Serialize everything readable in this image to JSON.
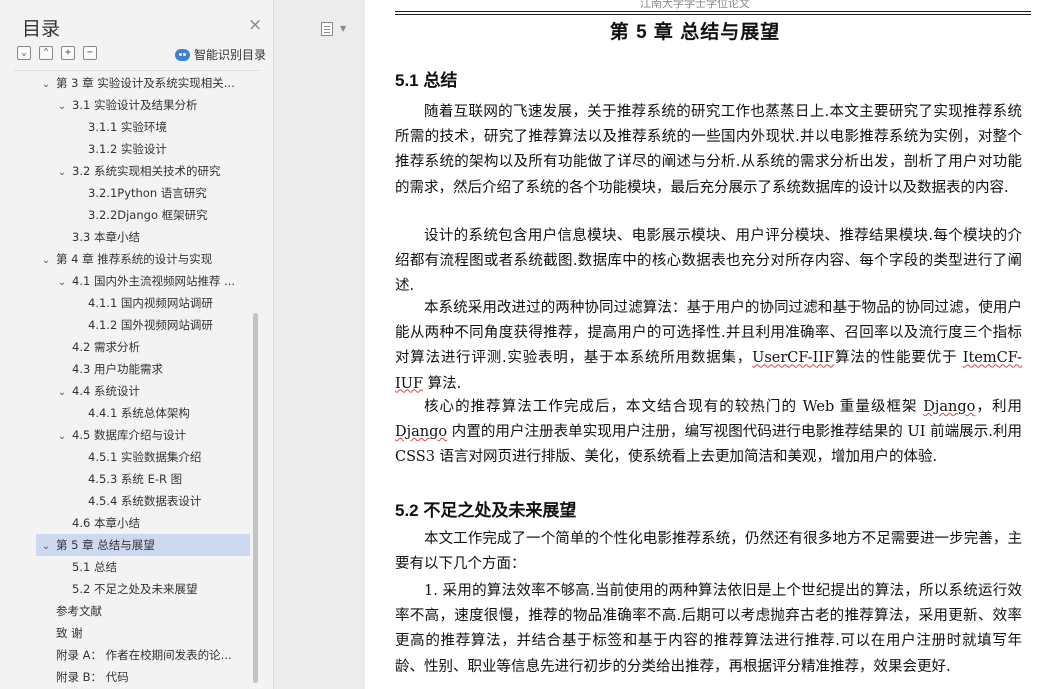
{
  "sidebar": {
    "title": "目录",
    "close_glyph": "×",
    "tools": [
      "⌄",
      "⌃",
      "+",
      "−"
    ],
    "ai_label": "智能识别目录",
    "toc": [
      {
        "label": "第 3 章 实验设计及系统实现相关...",
        "level": 1,
        "expand": true
      },
      {
        "label": "3.1 实验设计及结果分析",
        "level": 2,
        "expand": true
      },
      {
        "label": "3.1.1 实验环境",
        "level": 3,
        "expand": false
      },
      {
        "label": "3.1.2 实验设计",
        "level": 3,
        "expand": false
      },
      {
        "label": "3.2 系统实现相关技术的研究",
        "level": 2,
        "expand": true
      },
      {
        "label": "3.2.1Python 语言研究",
        "level": 3,
        "expand": false
      },
      {
        "label": "3.2.2Django 框架研究",
        "level": 3,
        "expand": false
      },
      {
        "label": "3.3 本章小结",
        "level": 2,
        "expand": false
      },
      {
        "label": "第 4 章 推荐系统的设计与实现",
        "level": 1,
        "expand": true
      },
      {
        "label": "4.1 国内外主流视频网站推荐 ...",
        "level": 2,
        "expand": true
      },
      {
        "label": "4.1.1 国内视频网站调研",
        "level": 3,
        "expand": false
      },
      {
        "label": "4.1.2 国外视频网站调研",
        "level": 3,
        "expand": false
      },
      {
        "label": "4.2 需求分析",
        "level": 2,
        "expand": false
      },
      {
        "label": "4.3 用户功能需求",
        "level": 2,
        "expand": false
      },
      {
        "label": "4.4 系统设计",
        "level": 2,
        "expand": true
      },
      {
        "label": "4.4.1 系统总体架构",
        "level": 3,
        "expand": false
      },
      {
        "label": "4.5 数据库介绍与设计",
        "level": 2,
        "expand": true
      },
      {
        "label": "4.5.1 实验数据集介绍",
        "level": 3,
        "expand": false
      },
      {
        "label": "4.5.3 系统 E-R 图",
        "level": 3,
        "expand": false
      },
      {
        "label": "4.5.4 系统数据表设计",
        "level": 3,
        "expand": false
      },
      {
        "label": "4.6 本章小结",
        "level": 2,
        "expand": false
      },
      {
        "label": "第 5 章 总结与展望",
        "level": 1,
        "expand": true,
        "selected": true
      },
      {
        "label": "5.1 总结",
        "level": 2,
        "expand": false
      },
      {
        "label": "5.2 不足之处及未来展望",
        "level": 2,
        "expand": false
      },
      {
        "label": "参考文献",
        "level": 1,
        "expand": false
      },
      {
        "label": "致 谢",
        "level": 1,
        "expand": false
      },
      {
        "label": "附录 A： 作者在校期间发表的论...",
        "level": 1,
        "expand": false
      },
      {
        "label": "附录 B： 代码",
        "level": 1,
        "expand": false
      }
    ]
  },
  "doc": {
    "running_head": "江南大学学士学位论文",
    "chapter_title": "第 5 章 总结与展望",
    "sections": [
      {
        "title": "5.1 总结",
        "paragraphs": [
          {
            "parts": [
              {
                "t": "随着互联网的飞速发展，关于推荐系统的研究工作也蒸蒸日上.本文主要研究了实现推荐系统所需的技术，研究了推荐算法以及推荐系统的一些国内外现状.并以电影推荐系统为实例，对整个推荐系统的架构以及所有功能做了详尽的阐述与分析.从系统的需求分析出发，剖析了用户对功能的需求，然后介绍了系统的各个功能模块，最后充分展示了系统数据库的设计以及数据表的内容."
              }
            ]
          },
          {
            "parts": [
              {
                "t": "设计的系统包含用户信息模块、电影展示模块、用户评分模块、推荐结果模块.每个模块的介绍都有流程图或者系统截图.数据库中的核心数据表也充分对所存内容、每个字段的类型进行了阐述."
              }
            ]
          },
          {
            "parts": [
              {
                "t": "本系统采用改进过的两种协同过滤算法：基于用户的协同过滤和基于物品的协同过滤，使用户能从两种不同角度获得推荐，提高用户的可选择性.并且利用准确率、召回率以及流行度三个指标对算法进行评测.实验表明，基于本系统所用数据集，"
              },
              {
                "t": "UserCF-IIF",
                "u": true
              },
              {
                "t": "算法的性能要优于 "
              },
              {
                "t": "ItemCF-IUF",
                "u": true
              },
              {
                "t": " 算法."
              }
            ]
          },
          {
            "parts": [
              {
                "t": "核心的推荐算法工作完成后，本文结合现有的较热门的 Web 重量级框架 "
              },
              {
                "t": "Django",
                "u": true
              },
              {
                "t": "，利用 "
              },
              {
                "t": "Django",
                "u": true
              },
              {
                "t": " 内置的用户注册表单实现用户注册，编写视图代码进行电影推荐结果的 UI 前端展示.利用 CSS3 语言对网页进行排版、美化，使系统看上去更加简洁和美观，增加用户的体验."
              }
            ]
          }
        ]
      },
      {
        "title": "5.2 不足之处及未来展望",
        "paragraphs": [
          {
            "parts": [
              {
                "t": "本文工作完成了一个简单的个性化电影推荐系统，仍然还有很多地方不足需要进一步完善，主要有以下几个方面："
              }
            ]
          },
          {
            "parts": [
              {
                "t": "1. 采用的算法效率不够高.当前使用的两种算法依旧是上个世纪提出的算法，所以系统运行效率不高，速度很慢，推荐的物品准确率不高.后期可以考虑抛弃古老的推荐算法，采用更新、效率更高的推荐算法，并结合基于标签和基于内容的推荐算法进行推荐.可以在用户注册时就填写年龄、性别、职业等信息先进行初步的分类给出推荐，再根据评分精准推荐，效果会更好."
              }
            ]
          }
        ]
      }
    ]
  },
  "colors": {
    "selected": "#cdd9f0",
    "accent": "#3b82d6",
    "sidebar_bg": "#f3f3f3"
  }
}
